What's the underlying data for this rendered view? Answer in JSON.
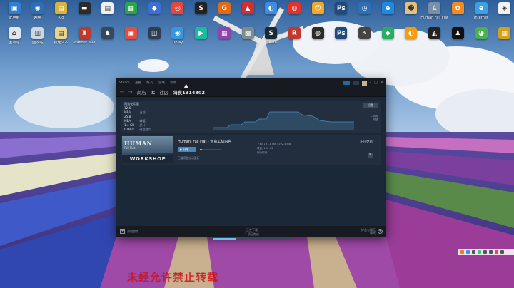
{
  "desktop": {
    "row1": [
      {
        "label": "此电脑",
        "color": "#2f7fd1",
        "glyph": "▣",
        "icon": "computer-icon"
      },
      {
        "label": "网络",
        "color": "#2a6fb8",
        "glyph": "◉",
        "icon": "network-icon"
      },
      {
        "label": "Rlo",
        "color": "#d9b43a",
        "glyph": "▤",
        "icon": "folder-icon"
      },
      {
        "label": "",
        "color": "#2b2b2b",
        "glyph": "▬",
        "icon": "app-icon"
      },
      {
        "label": "",
        "color": "#f0f0f0",
        "glyph": "▤",
        "icon": "document-icon"
      },
      {
        "label": "",
        "color": "#27a745",
        "glyph": "▦",
        "icon": "app-icon"
      },
      {
        "label": "",
        "color": "#3b6fd4",
        "glyph": "◆",
        "icon": "app-icon"
      },
      {
        "label": "",
        "color": "#e8453c",
        "glyph": "◎",
        "icon": "chrome-icon"
      },
      {
        "label": "",
        "color": "#222222",
        "glyph": "S",
        "icon": "steam-icon"
      },
      {
        "label": "",
        "color": "#e36a16",
        "glyph": "G",
        "icon": "app-icon"
      },
      {
        "label": "",
        "color": "#d32f2f",
        "glyph": "▲",
        "icon": "app-icon"
      },
      {
        "label": "",
        "color": "#3a8ee6",
        "glyph": "◐",
        "icon": "app-icon"
      },
      {
        "label": "",
        "color": "#e0332b",
        "glyph": "◍",
        "icon": "app-icon"
      },
      {
        "label": "",
        "color": "#f5a623",
        "glyph": "☺",
        "icon": "app-icon"
      },
      {
        "label": "",
        "color": "#1f4a7a",
        "glyph": "Ps",
        "icon": "photoshop-icon"
      },
      {
        "label": "",
        "color": "#2d6fb6",
        "glyph": "◷",
        "icon": "clock-icon"
      },
      {
        "label": "",
        "color": "#1e88e5",
        "glyph": "e",
        "icon": "edge-icon"
      },
      {
        "label": "",
        "color": "#e5c07b",
        "glyph": "☻",
        "icon": "app-icon"
      },
      {
        "label": "Human Fall Flat",
        "color": "#7a8ea8",
        "glyph": "♙",
        "icon": "game-icon"
      },
      {
        "label": "",
        "color": "#f28b21",
        "glyph": "✿",
        "icon": "app-icon"
      },
      {
        "label": "Internet",
        "color": "#3aa0e8",
        "glyph": "e",
        "icon": "ie-icon"
      },
      {
        "label": "",
        "color": "#f2f2f2",
        "glyph": "◈",
        "icon": "app-icon"
      }
    ],
    "row2": [
      {
        "label": "回收站",
        "color": "#dfe6ee",
        "glyph": "⌂",
        "icon": "recycle-bin-icon"
      },
      {
        "label": "回收站",
        "color": "#cfd8e0",
        "glyph": "▥",
        "icon": "trash-icon"
      },
      {
        "label": "新建文本",
        "color": "#e8d58a",
        "glyph": "▤",
        "icon": "text-file-icon"
      },
      {
        "label": "Wander Tale",
        "color": "#c0392b",
        "glyph": "♜",
        "icon": "game-icon"
      },
      {
        "label": "",
        "color": "#34495e",
        "glyph": "♞",
        "icon": "game-icon"
      },
      {
        "label": "",
        "color": "#e74c3c",
        "glyph": "▣",
        "icon": "app-icon"
      },
      {
        "label": "",
        "color": "#2c3e50",
        "glyph": "◫",
        "icon": "app-icon"
      },
      {
        "label": "Uplay",
        "color": "#3498db",
        "glyph": "◉",
        "icon": "uplay-icon"
      },
      {
        "label": "",
        "color": "#1abc9c",
        "glyph": "▶",
        "icon": "app-icon"
      },
      {
        "label": "",
        "color": "#8e44ad",
        "glyph": "▦",
        "icon": "app-icon"
      },
      {
        "label": "",
        "color": "#7f8c8d",
        "glyph": "▩",
        "icon": "app-icon"
      },
      {
        "label": "Steam",
        "color": "#1b2838",
        "glyph": "S",
        "icon": "steam-icon"
      },
      {
        "label": "",
        "color": "#c0392b",
        "glyph": "R",
        "icon": "rockstar-icon"
      },
      {
        "label": "",
        "color": "#2c2c2c",
        "glyph": "◍",
        "icon": "app-icon"
      },
      {
        "label": "",
        "color": "#1f4a7a",
        "glyph": "Ps",
        "icon": "photoshop-icon"
      },
      {
        "label": "",
        "color": "#444444",
        "glyph": "⚡",
        "icon": "app-icon"
      },
      {
        "label": "",
        "color": "#27ae60",
        "glyph": "◆",
        "icon": "app-icon"
      },
      {
        "label": "",
        "color": "#f39c12",
        "glyph": "◐",
        "icon": "app-icon"
      },
      {
        "label": "",
        "color": "#222222",
        "glyph": "◭",
        "icon": "unity-icon"
      },
      {
        "label": "",
        "color": "#111111",
        "glyph": "♟",
        "icon": "qq-icon"
      },
      {
        "label": "",
        "color": "#4caf50",
        "glyph": "◕",
        "icon": "app-icon"
      },
      {
        "label": "",
        "color": "#d4a017",
        "glyph": "▦",
        "icon": "app-icon"
      }
    ]
  },
  "steam": {
    "menu": [
      "Steam",
      "查看",
      "好友",
      "游戏",
      "帮助"
    ],
    "nav": {
      "back": "←",
      "forward": "→",
      "store": "商店",
      "library": "库",
      "community": "社区",
      "username": "冯良1314802"
    },
    "stats": {
      "header": "网络使用量",
      "rows": [
        {
          "value": "12.6 MB/s",
          "label": "当前"
        },
        {
          "value": "25.8 MB/s",
          "label": "峰值"
        },
        {
          "value": "1.4 GB",
          "label": "总计"
        },
        {
          "value": "0 MB/s",
          "label": "磁盘使用"
        }
      ],
      "legend": [
        "— 网络",
        "— 磁盘"
      ],
      "settings": "设置"
    },
    "download": {
      "game_name": "Human: Fall Flat - 创意工坊内容",
      "art_title": "HUMAN",
      "art_subtitle": "Fall Flat",
      "art_workshop": "WORKSHOP",
      "play": "▶ 开始",
      "progress": 0.1,
      "note": "已暂停此自动更新",
      "stats": [
        "下载: 191.1 MB / 192.3 MB",
        "硬盘: 192 MB",
        "剩余时间"
      ],
      "status": "正在更新",
      "remove": "✕"
    },
    "footer": {
      "add_game": "添加游戏",
      "downloading": "正在下载",
      "downloading_detail": "1 项已完成",
      "friends": "好友与聊天",
      "friends_line2": "聊天"
    }
  },
  "overlay": {
    "text": "未经允许禁止转载"
  }
}
